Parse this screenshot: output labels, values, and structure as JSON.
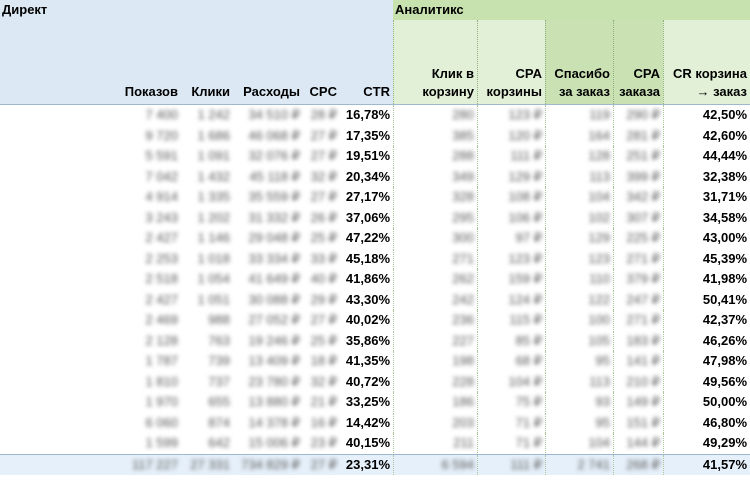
{
  "groups": {
    "direct": "Директ",
    "analytics": "Аналитикс"
  },
  "headers": {
    "impressions": "Показов",
    "clicks": "Клики",
    "spend": "Расходы",
    "cpc": "CPC",
    "ctr": "CTR",
    "cart_clicks": "Клик в корзину",
    "cpa_cart": "CPA корзины",
    "thanks": "Спасибо за заказ",
    "cpa_order": "CPA заказа",
    "cr": "CR корзина → заказ"
  },
  "rows": [
    {
      "impressions": "7 400",
      "clicks": "1 242",
      "spend": "34 510 ₽",
      "cpc": "28 ₽",
      "ctr": "16,78%",
      "cart": "280",
      "cpa_cart": "123 ₽",
      "thanks": "119",
      "cpa_order": "290 ₽",
      "cr": "42,50%"
    },
    {
      "impressions": "9 720",
      "clicks": "1 686",
      "spend": "46 068 ₽",
      "cpc": "27 ₽",
      "ctr": "17,35%",
      "cart": "385",
      "cpa_cart": "120 ₽",
      "thanks": "164",
      "cpa_order": "281 ₽",
      "cr": "42,60%"
    },
    {
      "impressions": "5 591",
      "clicks": "1 091",
      "spend": "32 076 ₽",
      "cpc": "27 ₽",
      "ctr": "19,51%",
      "cart": "288",
      "cpa_cart": "111 ₽",
      "thanks": "128",
      "cpa_order": "251 ₽",
      "cr": "44,44%"
    },
    {
      "impressions": "7 042",
      "clicks": "1 432",
      "spend": "45 118 ₽",
      "cpc": "32 ₽",
      "ctr": "20,34%",
      "cart": "349",
      "cpa_cart": "129 ₽",
      "thanks": "113",
      "cpa_order": "399 ₽",
      "cr": "32,38%"
    },
    {
      "impressions": "4 914",
      "clicks": "1 335",
      "spend": "35 559 ₽",
      "cpc": "27 ₽",
      "ctr": "27,17%",
      "cart": "328",
      "cpa_cart": "108 ₽",
      "thanks": "104",
      "cpa_order": "342 ₽",
      "cr": "31,71%"
    },
    {
      "impressions": "3 243",
      "clicks": "1 202",
      "spend": "31 332 ₽",
      "cpc": "26 ₽",
      "ctr": "37,06%",
      "cart": "295",
      "cpa_cart": "106 ₽",
      "thanks": "102",
      "cpa_order": "307 ₽",
      "cr": "34,58%"
    },
    {
      "impressions": "2 427",
      "clicks": "1 146",
      "spend": "29 048 ₽",
      "cpc": "25 ₽",
      "ctr": "47,22%",
      "cart": "300",
      "cpa_cart": "97 ₽",
      "thanks": "129",
      "cpa_order": "225 ₽",
      "cr": "43,00%"
    },
    {
      "impressions": "2 253",
      "clicks": "1 018",
      "spend": "33 334 ₽",
      "cpc": "33 ₽",
      "ctr": "45,18%",
      "cart": "271",
      "cpa_cart": "123 ₽",
      "thanks": "123",
      "cpa_order": "271 ₽",
      "cr": "45,39%"
    },
    {
      "impressions": "2 518",
      "clicks": "1 054",
      "spend": "41 649 ₽",
      "cpc": "40 ₽",
      "ctr": "41,86%",
      "cart": "262",
      "cpa_cart": "159 ₽",
      "thanks": "110",
      "cpa_order": "379 ₽",
      "cr": "41,98%"
    },
    {
      "impressions": "2 427",
      "clicks": "1 051",
      "spend": "30 088 ₽",
      "cpc": "29 ₽",
      "ctr": "43,30%",
      "cart": "242",
      "cpa_cart": "124 ₽",
      "thanks": "122",
      "cpa_order": "247 ₽",
      "cr": "50,41%"
    },
    {
      "impressions": "2 469",
      "clicks": "988",
      "spend": "27 052 ₽",
      "cpc": "27 ₽",
      "ctr": "40,02%",
      "cart": "236",
      "cpa_cart": "115 ₽",
      "thanks": "100",
      "cpa_order": "271 ₽",
      "cr": "42,37%"
    },
    {
      "impressions": "2 128",
      "clicks": "763",
      "spend": "19 246 ₽",
      "cpc": "25 ₽",
      "ctr": "35,86%",
      "cart": "227",
      "cpa_cart": "85 ₽",
      "thanks": "105",
      "cpa_order": "183 ₽",
      "cr": "46,26%"
    },
    {
      "impressions": "1 787",
      "clicks": "739",
      "spend": "13 409 ₽",
      "cpc": "18 ₽",
      "ctr": "41,35%",
      "cart": "198",
      "cpa_cart": "68 ₽",
      "thanks": "95",
      "cpa_order": "141 ₽",
      "cr": "47,98%"
    },
    {
      "impressions": "1 810",
      "clicks": "737",
      "spend": "23 780 ₽",
      "cpc": "32 ₽",
      "ctr": "40,72%",
      "cart": "228",
      "cpa_cart": "104 ₽",
      "thanks": "113",
      "cpa_order": "210 ₽",
      "cr": "49,56%"
    },
    {
      "impressions": "1 970",
      "clicks": "655",
      "spend": "13 880 ₽",
      "cpc": "21 ₽",
      "ctr": "33,25%",
      "cart": "186",
      "cpa_cart": "75 ₽",
      "thanks": "93",
      "cpa_order": "149 ₽",
      "cr": "50,00%"
    },
    {
      "impressions": "6 060",
      "clicks": "874",
      "spend": "14 378 ₽",
      "cpc": "16 ₽",
      "ctr": "14,42%",
      "cart": "203",
      "cpa_cart": "71 ₽",
      "thanks": "95",
      "cpa_order": "151 ₽",
      "cr": "46,80%"
    },
    {
      "impressions": "1 599",
      "clicks": "642",
      "spend": "15 006 ₽",
      "cpc": "23 ₽",
      "ctr": "40,15%",
      "cart": "211",
      "cpa_cart": "71 ₽",
      "thanks": "104",
      "cpa_order": "144 ₽",
      "cr": "49,29%"
    }
  ],
  "total": {
    "impressions": "117 227",
    "clicks": "27 331",
    "spend": "734 829 ₽",
    "cpc": "27 ₽",
    "ctr": "23,31%",
    "cart": "6 594",
    "cpa_cart": "111 ₽",
    "thanks": "2 741",
    "cpa_order": "268 ₽",
    "cr": "41,57%"
  }
}
